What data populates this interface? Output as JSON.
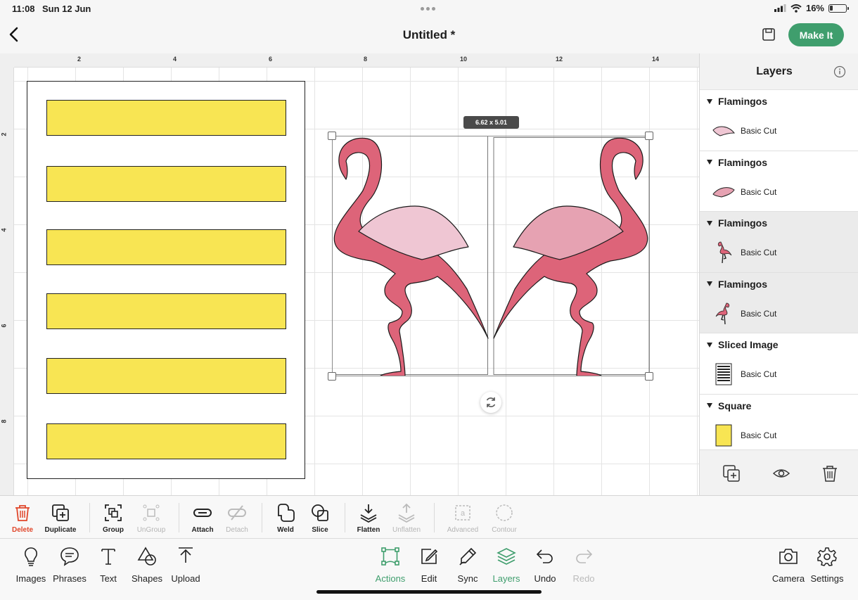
{
  "status_bar": {
    "time": "11:08",
    "date": "Sun 12 Jun",
    "battery": "16%"
  },
  "header": {
    "title": "Untitled *",
    "make_it": "Make It"
  },
  "ruler": {
    "top_ticks": [
      {
        "label": "2",
        "tag": "2"
      },
      {
        "label": "4",
        "tag": "4"
      },
      {
        "label": "6",
        "tag": "6"
      },
      {
        "label": "8",
        "tag": "8"
      },
      {
        "label": "10",
        "tag": "10"
      },
      {
        "label": "12",
        "tag": "12"
      },
      {
        "label": "14",
        "tag": "14"
      }
    ],
    "left_ticks": [
      {
        "label": "2",
        "tag": "2"
      },
      {
        "label": "4",
        "tag": "4"
      },
      {
        "label": "6",
        "tag": "6"
      },
      {
        "label": "8",
        "tag": "8"
      }
    ]
  },
  "canvas": {
    "selection_size": "6.62 x 5.01",
    "mat_bar_count": 6,
    "bar_color": "#f8e553"
  },
  "layers": {
    "title": "Layers",
    "groups": [
      {
        "name": "Flamingos",
        "operation": "Basic Cut",
        "thumb": "pink-wing-shape",
        "highlighted": false
      },
      {
        "name": "Flamingos",
        "operation": "Basic Cut",
        "thumb": "pink-wing-shape",
        "highlighted": false
      },
      {
        "name": "Flamingos",
        "operation": "Basic Cut",
        "thumb": "flamingo-shape",
        "highlighted": true
      },
      {
        "name": "Flamingos",
        "operation": "Basic Cut",
        "thumb": "flamingo-shape",
        "highlighted": true
      },
      {
        "name": "Sliced Image",
        "operation": "Basic Cut",
        "thumb": "striped-rectangle",
        "highlighted": false
      },
      {
        "name": "Square",
        "operation": "Basic Cut",
        "thumb": "yellow-rectangle",
        "highlighted": false
      }
    ]
  },
  "action_bar": {
    "delete": "Delete",
    "duplicate": "Duplicate",
    "group": "Group",
    "ungroup": "UnGroup",
    "attach": "Attach",
    "detach": "Detach",
    "weld": "Weld",
    "slice": "Slice",
    "flatten": "Flatten",
    "unflatten": "Unflatten",
    "advanced": "Advanced",
    "contour": "Contour"
  },
  "bottom_nav": {
    "images": "Images",
    "phrases": "Phrases",
    "text": "Text",
    "shapes": "Shapes",
    "upload": "Upload",
    "actions": "Actions",
    "edit": "Edit",
    "sync": "Sync",
    "layers": "Layers",
    "undo": "Undo",
    "redo": "Redo",
    "camera": "Camera",
    "settings": "Settings"
  },
  "colors": {
    "accent_green": "#3f9e6d",
    "delete_red": "#e0462a",
    "flamingo_pink": "#dd6479",
    "wing_light": "#efc6d3",
    "wing_mid": "#e6a2b2"
  }
}
